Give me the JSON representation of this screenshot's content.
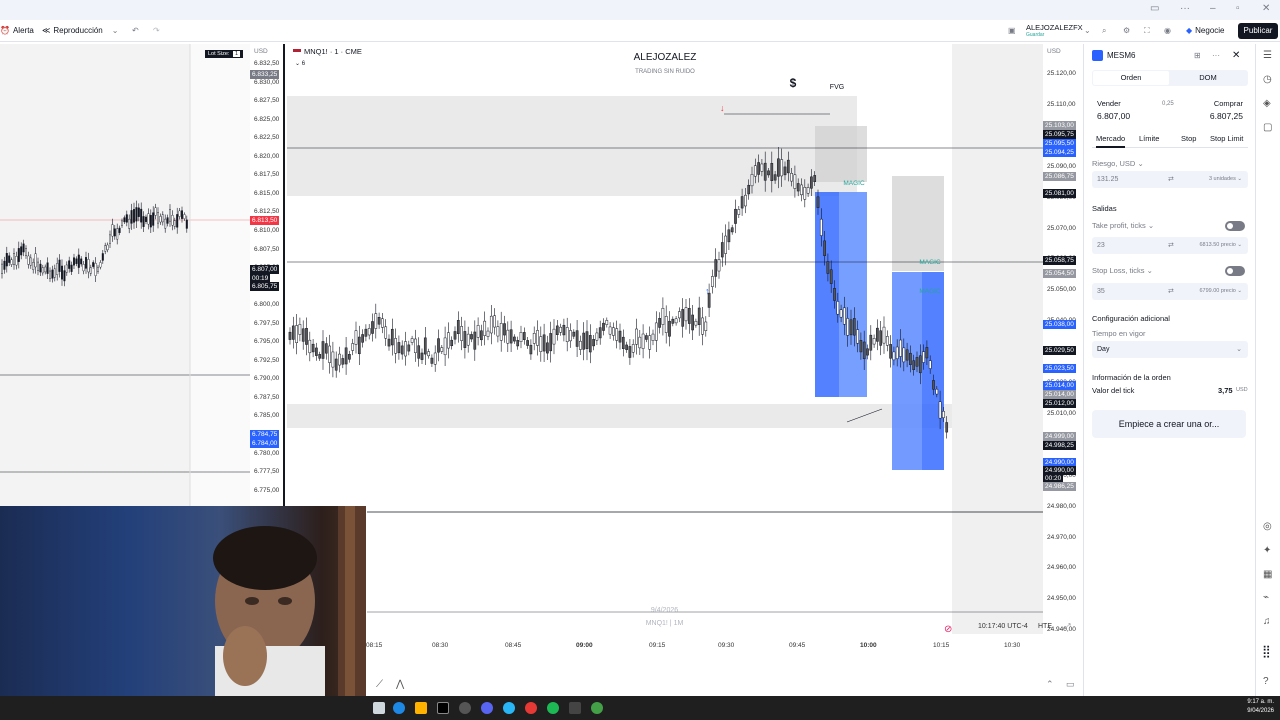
{
  "toolbar": {
    "alert": "Alerta",
    "replay": "Reproducción",
    "account_name": "ALEJOZALEZFX",
    "account_status": "Guardar",
    "trade": "Negocie",
    "publish": "Publicar"
  },
  "left_chart": {
    "lot_size": "Lot Size:",
    "lot_value": "1",
    "currency": "USD",
    "price_ticks": [
      "6.832,50",
      "6.830,00",
      "6.827,50",
      "6.825,00",
      "6.822,50",
      "6.820,00",
      "6.817,50",
      "6.815,00",
      "6.812,50",
      "6.810,00",
      "6.807,50",
      "6.805,00",
      "6.802,50",
      "6.800,00",
      "6.797,50",
      "6.795,00",
      "6.792,50",
      "6.790,00",
      "6.787,50",
      "6.785,00",
      "6.782,50",
      "6.780,00",
      "6.777,50",
      "6.775,00"
    ],
    "tags": [
      {
        "text": "6.833,25",
        "color": "#787b86"
      },
      {
        "text": "6.813,50",
        "color": "#f23645"
      },
      {
        "text": "6.807,00",
        "color": "#131722"
      },
      {
        "text": "00:19",
        "color": "#131722"
      },
      {
        "text": "6.805,75",
        "color": "#131722"
      },
      {
        "text": "6.784,75",
        "color": "#2962ff"
      },
      {
        "text": "6.784,00",
        "color": "#2962ff"
      }
    ]
  },
  "main_chart": {
    "symbol": "MNQ1! · 1 · CME",
    "indicator_count": "6",
    "watermark_title": "ALEJOZALEZ",
    "watermark_sub": "TRADING SIN RUIDO",
    "dollar_label": "$",
    "fvg_label": "FVG",
    "magic_label": "MAGIC",
    "currency": "USD",
    "date_watermark": "9/4/2026",
    "symbol_watermark": "MNQ1! | 1M",
    "price_ticks": [
      "25.120,00",
      "25.110,00",
      "25.100,00",
      "25.090,00",
      "25.080,00",
      "25.070,00",
      "25.060,00",
      "25.050,00",
      "25.040,00",
      "25.030,00",
      "25.020,00",
      "25.010,00",
      "25.000,00",
      "24.990,00",
      "24.980,00",
      "24.970,00",
      "24.960,00",
      "24.950,00",
      "24.940,00"
    ],
    "tags": [
      {
        "text": "25.103,00",
        "color": "#9598a1"
      },
      {
        "text": "25.095,75",
        "color": "#131722"
      },
      {
        "text": "25.095,50",
        "color": "#2962ff"
      },
      {
        "text": "25.094,25",
        "color": "#2962ff"
      },
      {
        "text": "25.086,75",
        "color": "#9598a1"
      },
      {
        "text": "25.081,00",
        "color": "#131722"
      },
      {
        "text": "25.058,75",
        "color": "#131722"
      },
      {
        "text": "25.054,50",
        "color": "#9598a1"
      },
      {
        "text": "25.038,00",
        "color": "#2962ff"
      },
      {
        "text": "25.029,50",
        "color": "#131722"
      },
      {
        "text": "25.023,50",
        "color": "#2962ff"
      },
      {
        "text": "25.014,00",
        "color": "#2962ff"
      },
      {
        "text": "25.014,00",
        "color": "#9598a1"
      },
      {
        "text": "25.012,00",
        "color": "#131722"
      },
      {
        "text": "24.999,00",
        "color": "#9598a1"
      },
      {
        "text": "24.998,25",
        "color": "#131722"
      },
      {
        "text": "24.990,00",
        "color": "#2962ff"
      },
      {
        "text": "24.990,00",
        "color": "#131722"
      },
      {
        "text": "00:20",
        "color": "#131722"
      },
      {
        "text": "24.986,25",
        "color": "#9598a1"
      }
    ],
    "time_ticks": [
      "08:15",
      "08:30",
      "08:45",
      "09:00",
      "09:15",
      "09:30",
      "09:45",
      "10:00",
      "10:15",
      "10:30"
    ],
    "clock": "10:17:40 UTC-4",
    "session": "HTE"
  },
  "order_panel": {
    "symbol": "MESM6",
    "tab_order": "Orden",
    "tab_dom": "DOM",
    "sell_label": "Vender",
    "sell_price": "6.807,00",
    "spread": "0,25",
    "buy_label": "Comprar",
    "buy_price": "6.807,25",
    "types": [
      "Mercado",
      "Límite",
      "Stop",
      "Stop Limit"
    ],
    "risk_label": "Riesgo, USD",
    "risk_value": "131.25",
    "units": "3 unidades",
    "exits_label": "Salidas",
    "tp_label": "Take profit, ticks",
    "tp_value": "23",
    "tp_price": "6813.50 precio",
    "sl_label": "Stop Loss, ticks",
    "sl_value": "35",
    "sl_price": "6799.00 precio",
    "extra_config": "Configuración adicional",
    "tif_label": "Tiempo en vigor",
    "tif_value": "Day",
    "order_info": "Información de la orden",
    "tick_value_label": "Valor del tick",
    "tick_value": "3,75",
    "tick_currency": "USD",
    "cta": "Empiece a crear una or..."
  },
  "taskbar": {
    "time": "9:17 a. m.",
    "date": "9/04/2026"
  }
}
